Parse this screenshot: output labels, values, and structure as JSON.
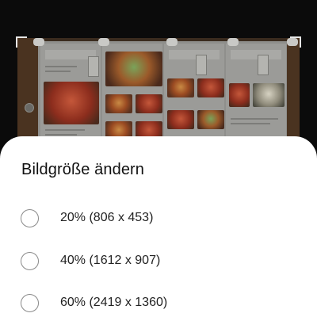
{
  "dialog": {
    "title": "Bildgröße ändern",
    "options": [
      {
        "label": "20% (806 x 453)",
        "selected": false
      },
      {
        "label": "40% (1612 x 907)",
        "selected": false
      },
      {
        "label": "60% (2419 x 1360)",
        "selected": false
      }
    ]
  },
  "colors": {
    "sheet_background": "#ffffff",
    "title_text": "#111111",
    "radio_border": "#8a8a8a",
    "backdrop": "#0b0b0b"
  }
}
